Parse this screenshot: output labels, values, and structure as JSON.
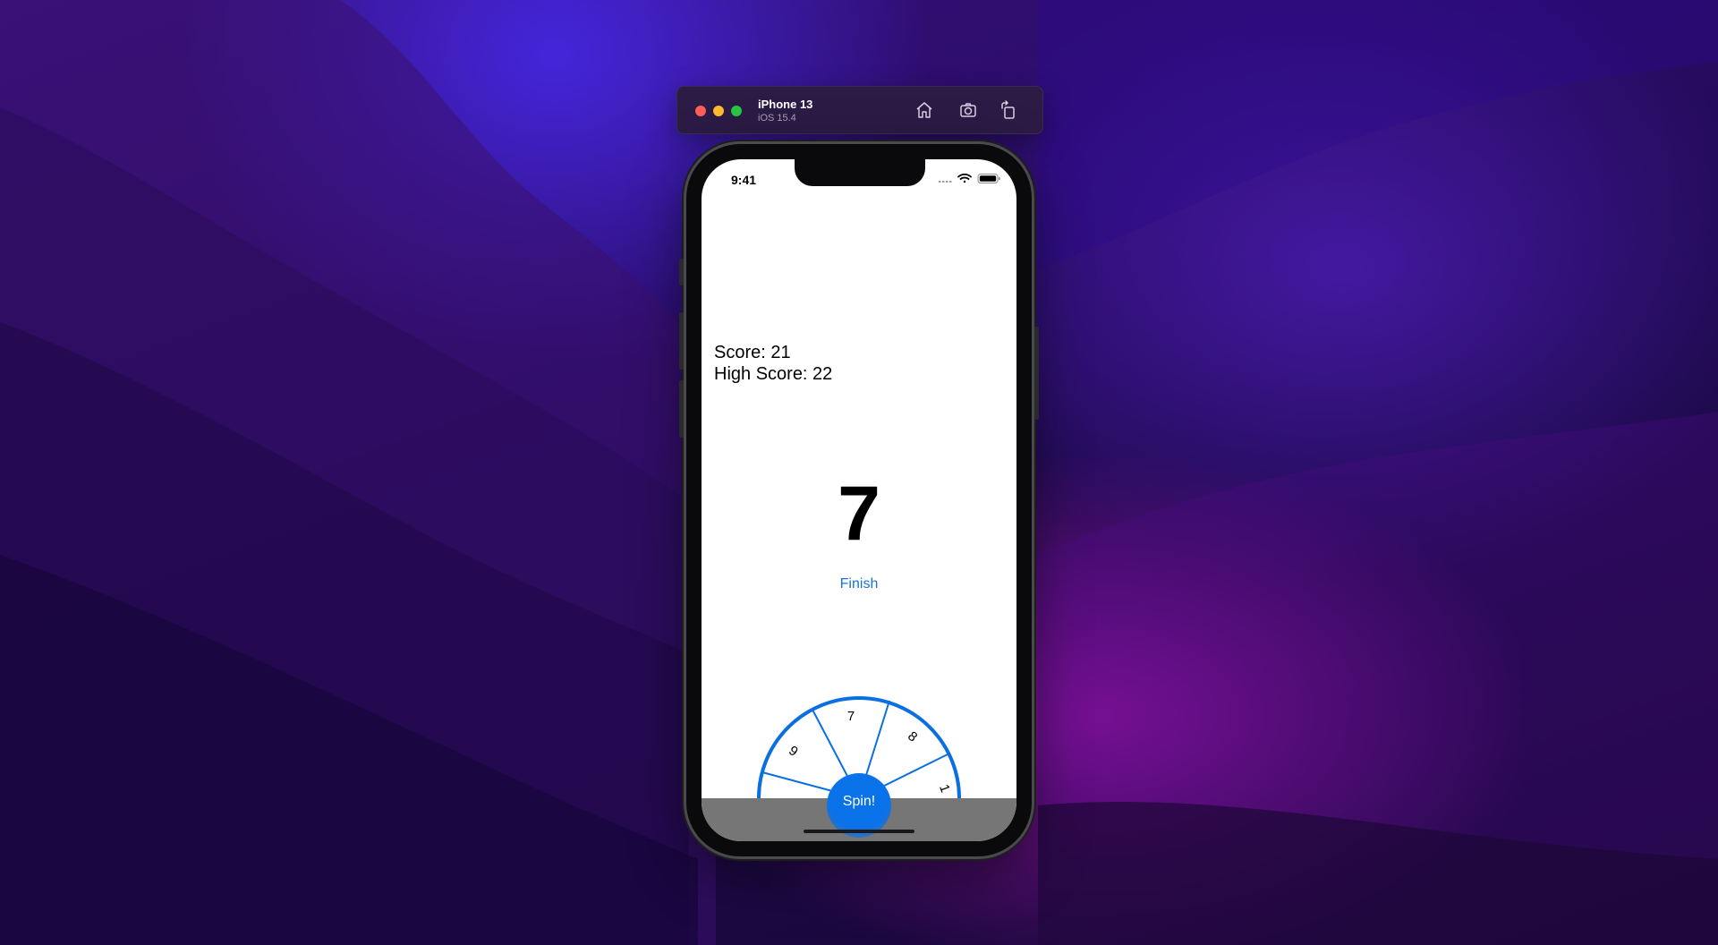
{
  "simulator": {
    "device_name": "iPhone 13",
    "os_version": "iOS 15.4",
    "toolbar_icons": [
      "home-icon",
      "screenshot-icon",
      "rotate-icon"
    ]
  },
  "status_bar": {
    "time": "9:41",
    "icons": [
      "cellular-icon",
      "wifi-icon",
      "battery-icon"
    ]
  },
  "game": {
    "score_label": "Score: 21",
    "high_score_label": "High Score: 22",
    "current_number": "7",
    "finish_label": "Finish",
    "spin_label": "Spin!",
    "wheel_visible_numbers": [
      "6",
      "7",
      "8",
      "1"
    ]
  },
  "colors": {
    "accent": "#1a73d9",
    "wheel_stroke": "#0a6fe0",
    "spin_button": "#0a72e8",
    "bottom_bar": "#767676"
  }
}
